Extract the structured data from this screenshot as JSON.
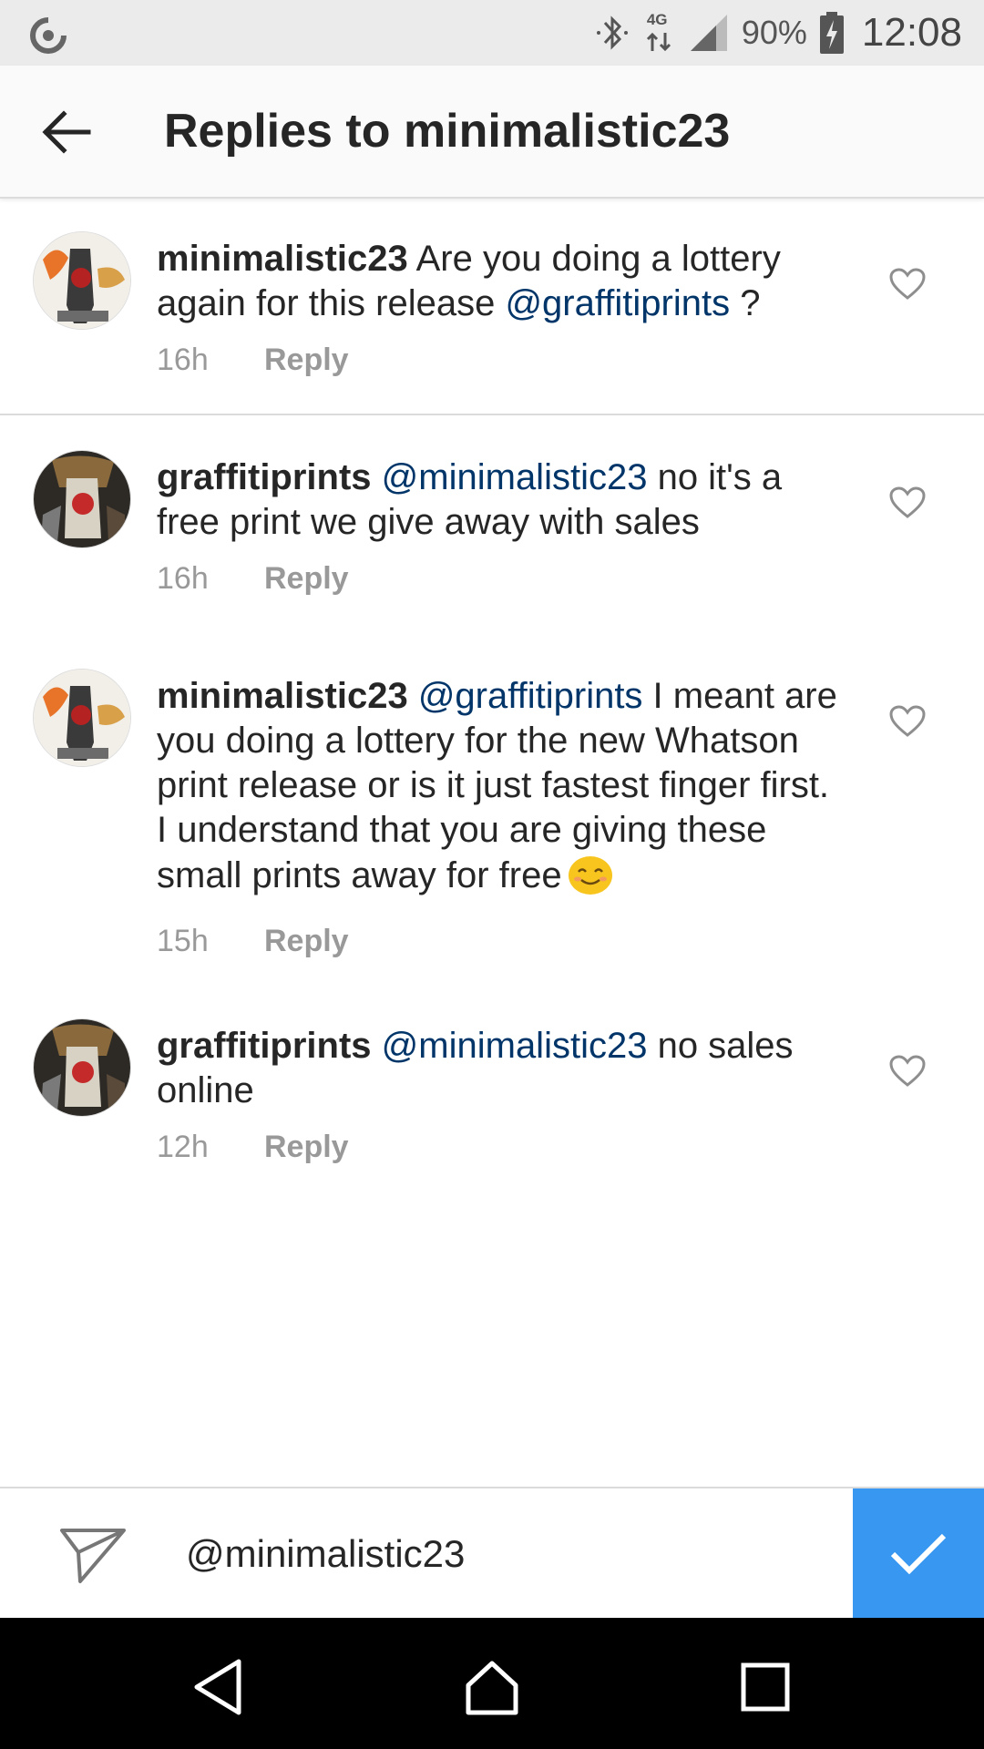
{
  "status_bar": {
    "network_label": "4G",
    "battery_percent": "90%",
    "time": "12:08",
    "icons": [
      "sync-icon",
      "bluetooth-icon",
      "network-arrows-icon",
      "signal-icon",
      "battery-charging-icon"
    ]
  },
  "header": {
    "title": "Replies to minimalistic23",
    "back_icon": "arrow-left-icon"
  },
  "comments": [
    {
      "username": "minimalistic23",
      "text_before": " Are you doing a lottery again for this release ",
      "mention": "@graffitiprints",
      "text_after": " ?",
      "time": "16h",
      "reply_label": "Reply"
    },
    {
      "username": "graffitiprints",
      "text_before": " ",
      "mention": "@minimalistic23",
      "text_after": " no it's a free print we give away with sales",
      "time": "16h",
      "reply_label": "Reply"
    },
    {
      "username": "minimalistic23",
      "text_before": " ",
      "mention": "@graffitiprints",
      "text_after": " I meant are you doing a lottery for the new What­son print release or is it just fastest fin­ger first. I understand that you are giving these small prints away for free",
      "emoji": "smiling-face-emoji",
      "time": "15h",
      "reply_label": "Reply"
    },
    {
      "username": "graffitiprints",
      "text_before": " ",
      "mention": "@minimalistic23",
      "text_after": " no sales online",
      "time": "12h",
      "reply_label": "Reply"
    }
  ],
  "compose": {
    "value": "@minimalistic23",
    "send_icon": "paper-plane-icon",
    "post_icon": "checkmark-icon"
  },
  "nav_bar": {
    "icons": [
      "back-triangle-icon",
      "home-icon",
      "recents-square-icon"
    ]
  },
  "colors": {
    "mention": "#003569",
    "accent": "#3897f0",
    "meta": "#999999"
  }
}
